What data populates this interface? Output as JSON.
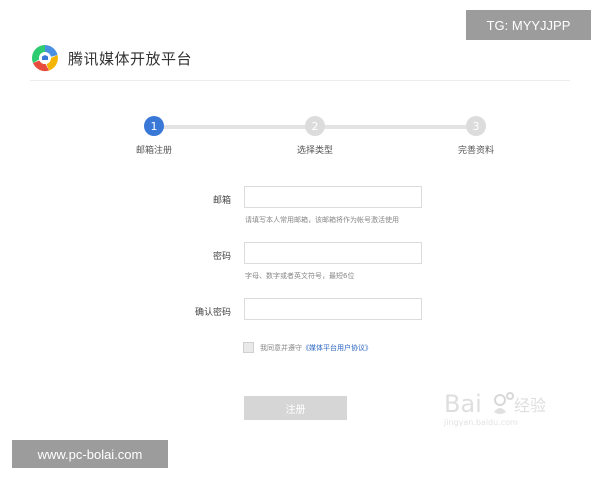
{
  "header": {
    "title": "腾讯媒体开放平台",
    "logo_icon": "tencent-media-logo-icon"
  },
  "steps": [
    {
      "number": "1",
      "label": "邮箱注册",
      "active": true
    },
    {
      "number": "2",
      "label": "选择类型",
      "active": false
    },
    {
      "number": "3",
      "label": "完善资料",
      "active": false
    }
  ],
  "form": {
    "email": {
      "label": "邮箱",
      "value": "",
      "hint": "请填写本人常用邮箱，该邮箱将作为帐号激活使用"
    },
    "password": {
      "label": "密码",
      "value": "",
      "hint": "字母、数字或者英文符号，最短6位"
    },
    "confirm": {
      "label": "确认密码",
      "value": ""
    },
    "agree": {
      "checked": false,
      "text": "我同意并遵守",
      "link_text": "《媒体平台用户协议》"
    },
    "submit_label": "注册"
  },
  "overlays": {
    "tg": "TG: MYYJJPP",
    "site": "www.pc-bolai.com"
  },
  "colors": {
    "accent": "#3a78d8",
    "link": "#2b66c2",
    "disabled_button": "#d6d6d6",
    "badge": "#9c9c9c"
  }
}
